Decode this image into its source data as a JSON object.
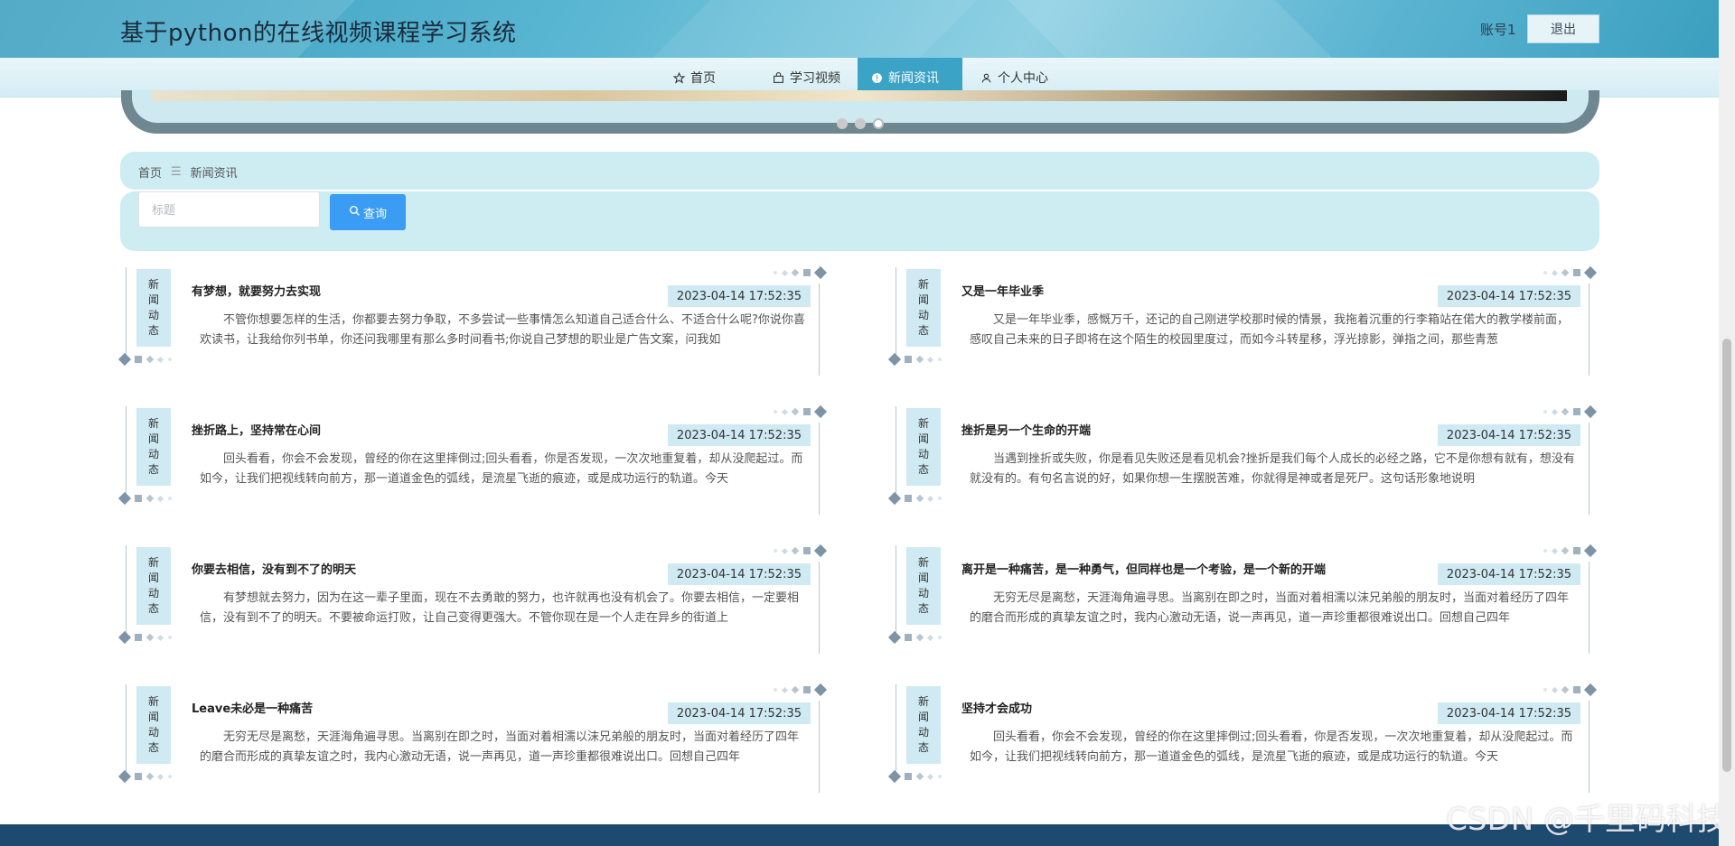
{
  "header": {
    "site_title": "基于python的在线视频课程学习系统",
    "account": "账号1",
    "logout_label": "退出"
  },
  "nav": {
    "items": [
      {
        "label": "首页",
        "icon": "star-icon",
        "active": false
      },
      {
        "label": "学习视频",
        "icon": "bag-icon",
        "active": false
      },
      {
        "label": "新闻资讯",
        "icon": "info-icon",
        "active": true
      },
      {
        "label": "个人中心",
        "icon": "user-icon",
        "active": false
      }
    ]
  },
  "carousel": {
    "dots": 3,
    "active_index": 2
  },
  "breadcrumb": {
    "home": "首页",
    "separator": "☰",
    "current": "新闻资讯"
  },
  "search": {
    "placeholder": "标题",
    "value": "",
    "button_label": "查询",
    "button_icon": "search-icon"
  },
  "news": {
    "tag_chars": [
      "新",
      "闻",
      "动",
      "态"
    ],
    "items": [
      {
        "title": "有梦想，就要努力去实现",
        "date": "2023-04-14 17:52:35",
        "summary": "不管你想要怎样的生活，你都要去努力争取，不多尝试一些事情怎么知道自己适合什么、不适合什么呢?你说你喜欢读书，让我给你列书单，你还问我哪里有那么多时间看书;你说自己梦想的职业是广告文案，问我如"
      },
      {
        "title": "又是一年毕业季",
        "date": "2023-04-14 17:52:35",
        "summary": "又是一年毕业季，感慨万千，还记的自己刚进学校那时候的情景，我拖着沉重的行李箱站在偌大的教学楼前面，感叹自己未来的日子即将在这个陌生的校园里度过，而如今斗转星移，浮光掠影，弹指之间，那些青葱"
      },
      {
        "title": "挫折路上，坚持常在心间",
        "date": "2023-04-14 17:52:35",
        "summary": "回头看看，你会不会发现，曾经的你在这里摔倒过;回头看看，你是否发现，一次次地重复着，却从没爬起过。而如今，让我们把视线转向前方，那一道道金色的弧线，是流星飞逝的痕迹，或是成功运行的轨道。今天"
      },
      {
        "title": "挫折是另一个生命的开端",
        "date": "2023-04-14 17:52:35",
        "summary": "当遇到挫折或失败，你是看见失败还是看见机会?挫折是我们每个人成长的必经之路，它不是你想有就有，想没有就没有的。有句名言说的好，如果你想一生摆脱苦难，你就得是神或者是死尸。这句话形象地说明"
      },
      {
        "title": "你要去相信，没有到不了的明天",
        "date": "2023-04-14 17:52:35",
        "summary": "有梦想就去努力，因为在这一辈子里面，现在不去勇敢的努力，也许就再也没有机会了。你要去相信，一定要相信，没有到不了的明天。不要被命运打败，让自己变得更强大。不管你现在是一个人走在异乡的街道上"
      },
      {
        "title": "离开是一种痛苦，是一种勇气，但同样也是一个考验，是一个新的开端",
        "date": "2023-04-14 17:52:35",
        "summary": "无穷无尽是离愁，天涯海角遍寻思。当离别在即之时，当面对着相濡以沫兄弟般的朋友时，当面对着经历了四年的磨合而形成的真挚友谊之时，我内心激动无语，说一声再见，道一声珍重都很难说出口。回想自己四年"
      },
      {
        "title": "Leave未必是一种痛苦",
        "date": "2023-04-14 17:52:35",
        "summary": "无穷无尽是离愁，天涯海角遍寻思。当离别在即之时，当面对着相濡以沫兄弟般的朋友时，当面对着经历了四年的磨合而形成的真挚友谊之时，我内心激动无语，说一声再见，道一声珍重都很难说出口。回想自己四年"
      },
      {
        "title": "坚持才会成功",
        "date": "2023-04-14 17:52:35",
        "summary": "回头看看，你会不会发现，曾经的你在这里摔倒过;回头看看，你是否发现，一次次地重复着，却从没爬起过。而如今，让我们把视线转向前方，那一道道金色的弧线，是流星飞逝的痕迹，或是成功运行的轨道。今天"
      }
    ]
  },
  "watermark": "CSDN @千里码科技"
}
